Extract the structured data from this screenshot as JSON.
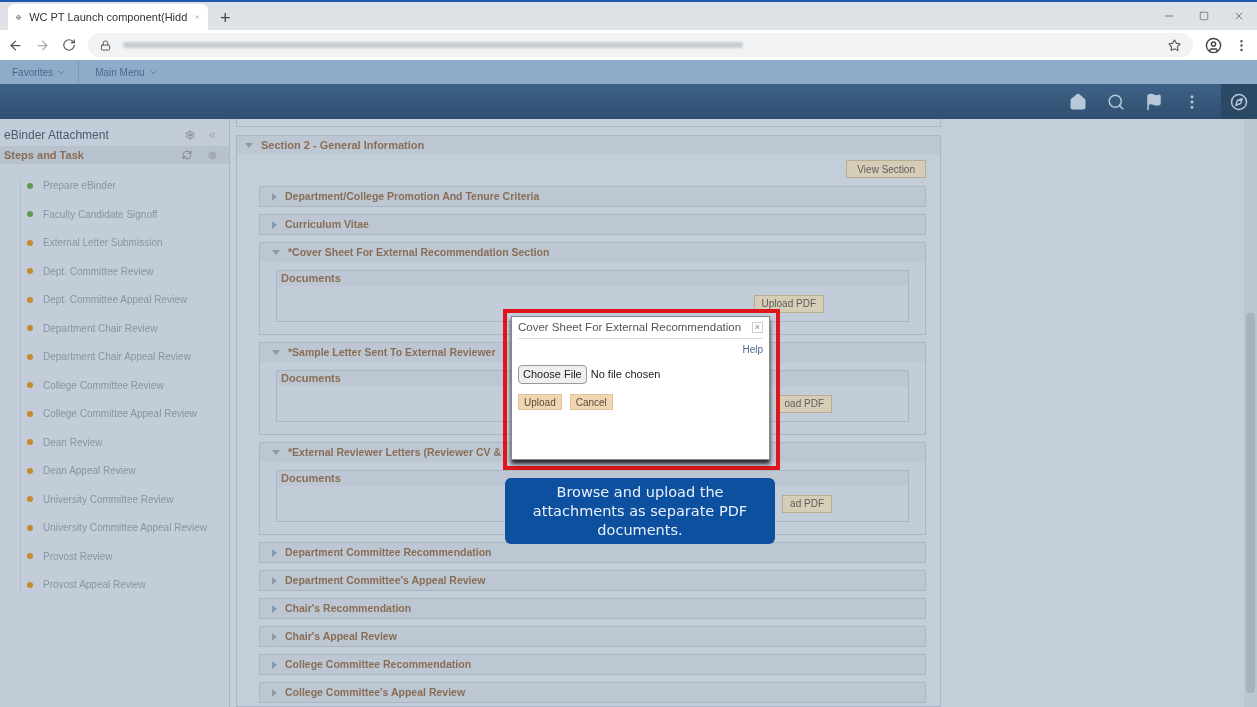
{
  "browser": {
    "tab_title": "WC PT Launch component(Hidd",
    "new_tab": "+"
  },
  "favorites_bar": {
    "items": [
      {
        "label": "Favorites"
      },
      {
        "label": "Main Menu"
      }
    ]
  },
  "sidebar": {
    "title": "eBinder Attachment",
    "subtitle": "Steps and Task",
    "steps": [
      {
        "label": "Prepare eBinder",
        "color": "#5f9a4a"
      },
      {
        "label": "Faculty Candidate Signoff",
        "color": "#5f9a4a"
      },
      {
        "label": "External Letter Submission",
        "color": "#c98a2c"
      },
      {
        "label": "Dept. Committee Review",
        "color": "#c98a2c"
      },
      {
        "label": "Dept. Committee Appeal Review",
        "color": "#c98a2c"
      },
      {
        "label": "Department Chair Review",
        "color": "#c98a2c"
      },
      {
        "label": "Department Chair Appeal Review",
        "color": "#c98a2c"
      },
      {
        "label": "College Committee Review",
        "color": "#c98a2c"
      },
      {
        "label": "College Committee Appeal Review",
        "color": "#c98a2c"
      },
      {
        "label": "Dean Review",
        "color": "#c98a2c"
      },
      {
        "label": "Dean Appeal Review",
        "color": "#c98a2c"
      },
      {
        "label": "University Committee Review",
        "color": "#c98a2c"
      },
      {
        "label": "University Committee Appeal Review",
        "color": "#c98a2c"
      },
      {
        "label": "Provost Review",
        "color": "#c98a2c"
      },
      {
        "label": "Provost Appeal Review",
        "color": "#c98a2c"
      }
    ]
  },
  "section": {
    "title": "Section 2 - General Information",
    "expanded": true,
    "view_button": "View Section",
    "subsections": [
      {
        "title": "Department/College Promotion And Tenure Criteria",
        "expanded": false
      },
      {
        "title": "Curriculum Vitae",
        "expanded": false
      },
      {
        "title": "*Cover Sheet For External Recommendation Section",
        "expanded": true,
        "documents_label": "Documents",
        "upload_button": "Upload PDF"
      },
      {
        "title": "*Sample Letter Sent To External Reviewer",
        "expanded": true,
        "documents_label": "Documents",
        "upload_button": "oad PDF"
      },
      {
        "title": "*External Reviewer Letters (Reviewer CV &",
        "expanded": true,
        "documents_label": "Documents",
        "upload_button": "ad PDF"
      },
      {
        "title": "Department Committee Recommendation",
        "expanded": false
      },
      {
        "title": "Department Committee's Appeal Review",
        "expanded": false
      },
      {
        "title": "Chair's Recommendation",
        "expanded": false
      },
      {
        "title": "Chair's Appeal Review",
        "expanded": false
      },
      {
        "title": "College Committee Recommendation",
        "expanded": false
      },
      {
        "title": "College Committee's Appeal Review",
        "expanded": false
      }
    ]
  },
  "dialog": {
    "title": "Cover Sheet For External Recommendation",
    "close": "×",
    "help": "Help",
    "choose_file": "Choose File",
    "file_status": "No file chosen",
    "buttons": [
      "Upload",
      "Cancel"
    ]
  },
  "callout": {
    "text": "Browse and upload the attachments as separate PDF documents."
  }
}
